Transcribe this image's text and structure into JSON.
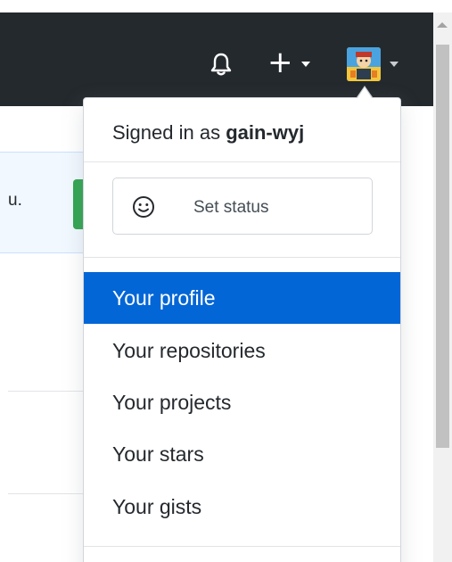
{
  "header": {
    "bell_icon": "bell-icon",
    "plus_symbol": "+",
    "create_icon": "plus-icon",
    "avatar_icon": "avatar-image"
  },
  "background": {
    "banner_text": "u."
  },
  "dropdown": {
    "signed_in_prefix": "Signed in as ",
    "username": "gain-wyj",
    "set_status": {
      "icon": "smiley-icon",
      "label": "Set status"
    },
    "items": [
      {
        "label": "Your profile",
        "active": true
      },
      {
        "label": "Your repositories",
        "active": false
      },
      {
        "label": "Your projects",
        "active": false
      },
      {
        "label": "Your stars",
        "active": false
      },
      {
        "label": "Your gists",
        "active": false
      }
    ]
  },
  "colors": {
    "header_bg": "#24292e",
    "active_item_bg": "#0366d6",
    "active_item_text": "#ffffff",
    "banner_bg": "#f1f8ff",
    "green_button": "#2ea44f"
  }
}
